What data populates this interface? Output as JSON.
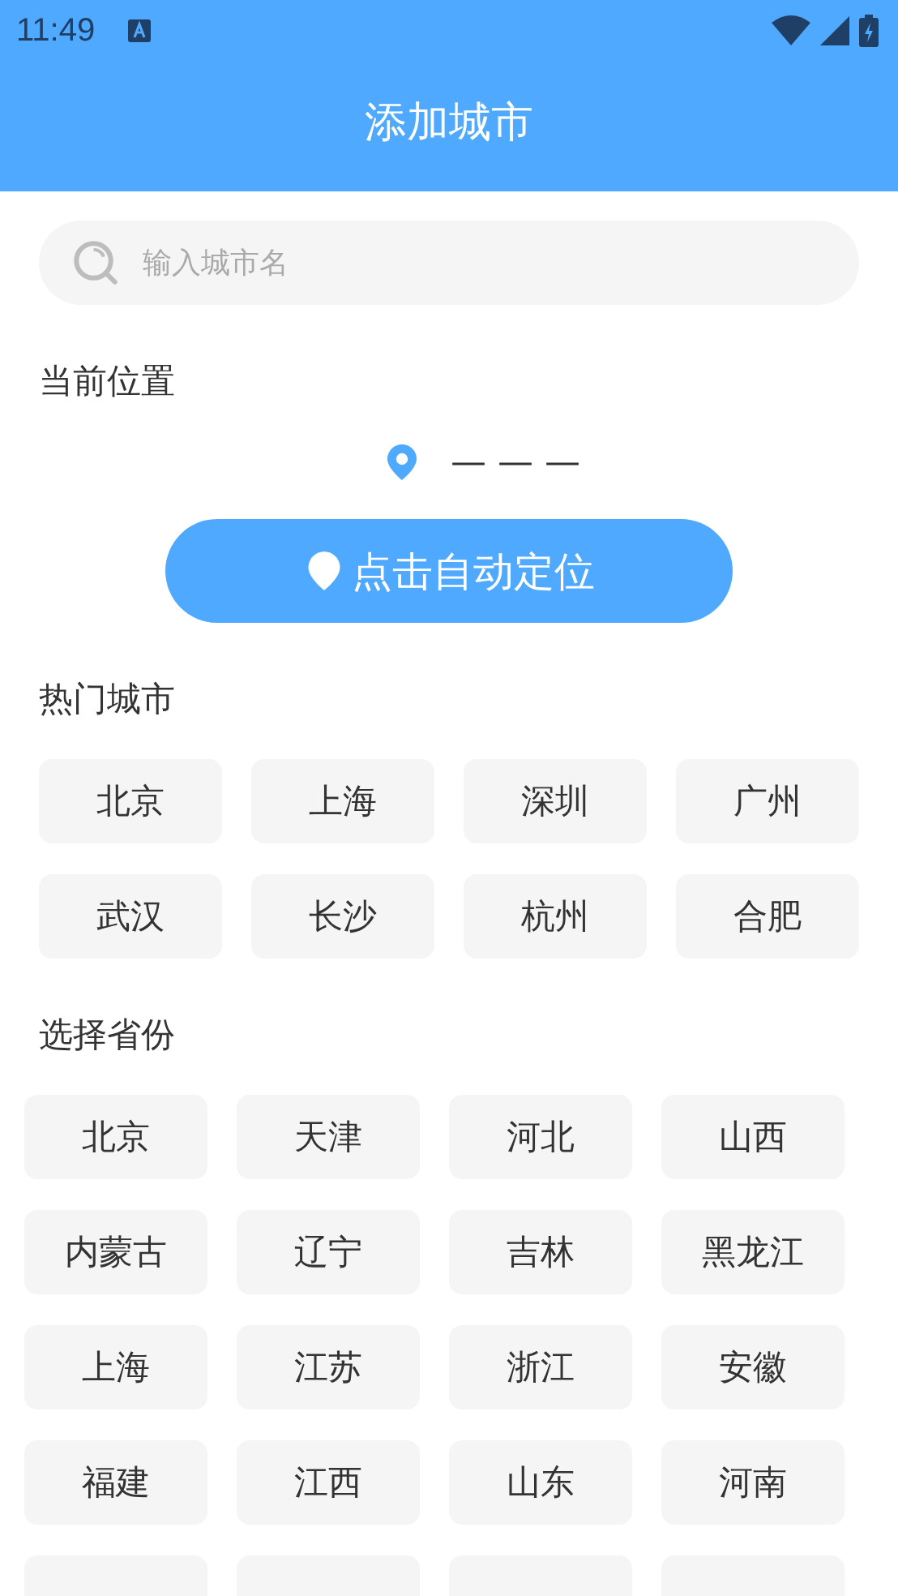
{
  "status_bar": {
    "time": "11:49"
  },
  "header": {
    "title": "添加城市"
  },
  "search": {
    "placeholder": "输入城市名"
  },
  "current_location": {
    "label": "当前位置",
    "value": "— — —",
    "button": "点击自动定位"
  },
  "hot_cities": {
    "label": "热门城市",
    "items": [
      "北京",
      "上海",
      "深圳",
      "广州",
      "武汉",
      "长沙",
      "杭州",
      "合肥"
    ]
  },
  "provinces": {
    "label": "选择省份",
    "items": [
      "北京",
      "天津",
      "河北",
      "山西",
      "内蒙古",
      "辽宁",
      "吉林",
      "黑龙江",
      "上海",
      "江苏",
      "浙江",
      "安徽",
      "福建",
      "江西",
      "山东",
      "河南"
    ]
  }
}
